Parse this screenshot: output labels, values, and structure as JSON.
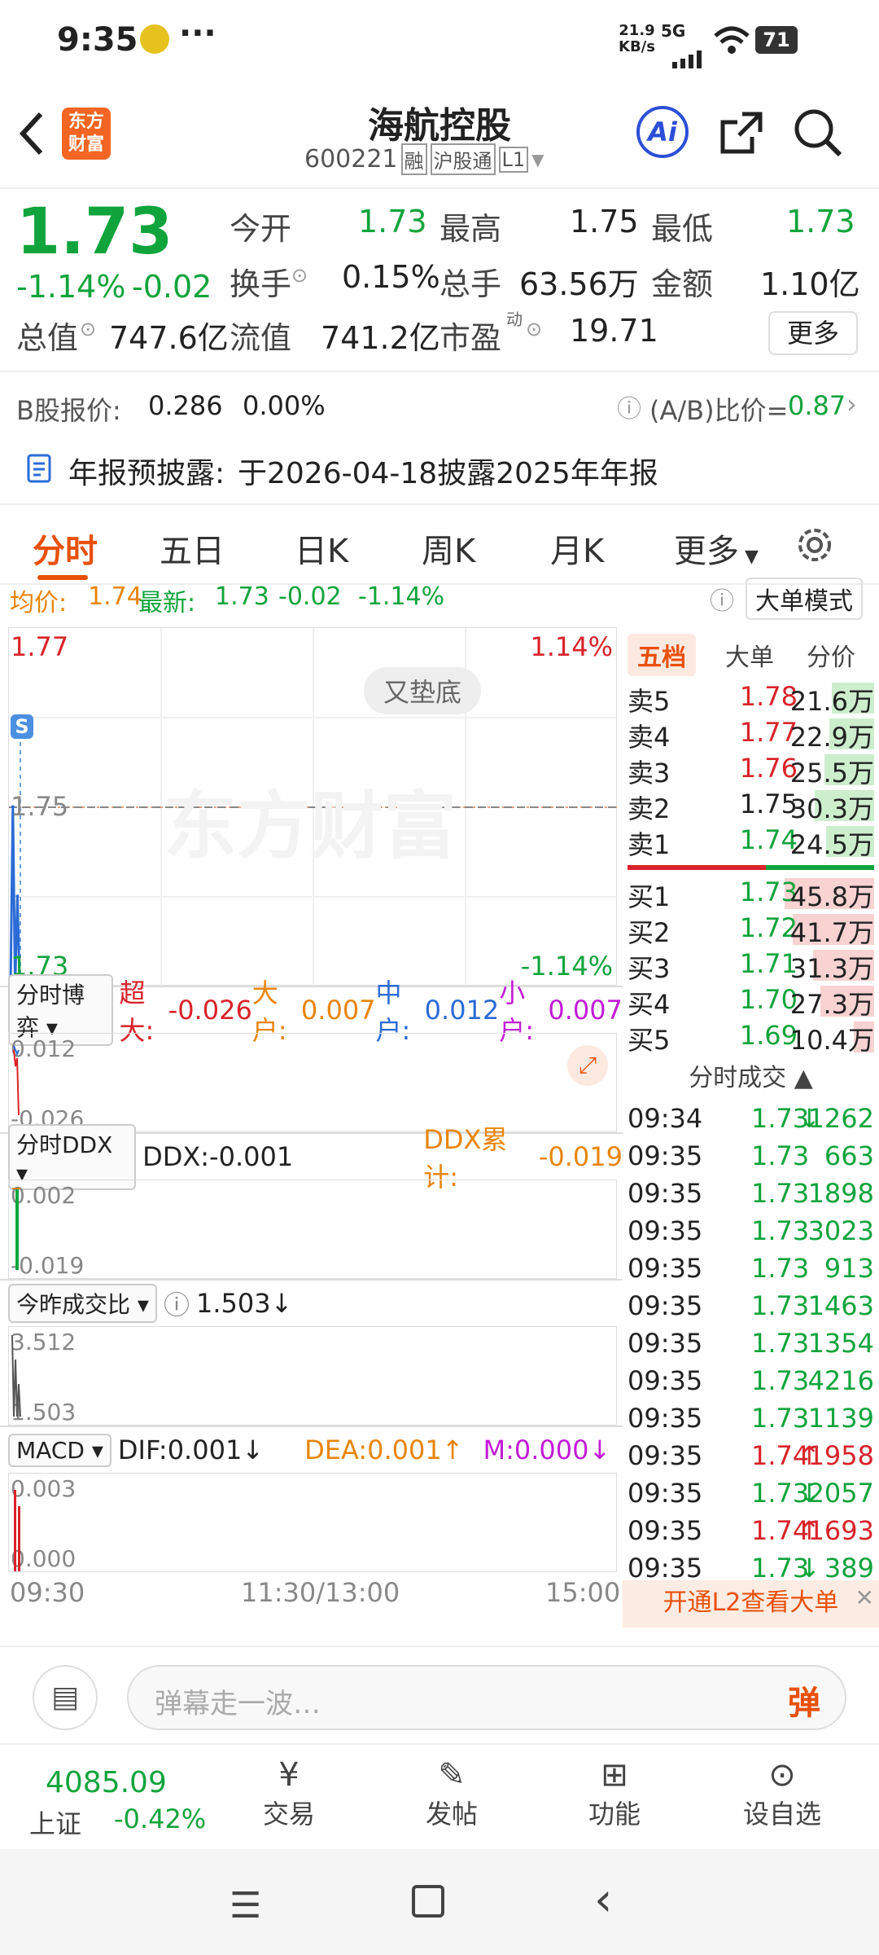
{
  "status": {
    "time": "9:35",
    "net_speed": "21.9",
    "net_unit": "KB/s",
    "net_type": "5G",
    "battery": "71"
  },
  "header": {
    "title": "海航控股",
    "code": "600221",
    "tag_rong": "融",
    "tag_hgt": "沪股通",
    "tag_level": "L1",
    "logo_line1": "东方",
    "logo_line2": "财富",
    "ai": "Ai"
  },
  "quote": {
    "price": "1.73",
    "change_pct": "-1.14%",
    "change": "-0.02",
    "open_label": "今开",
    "open": "1.73",
    "high_label": "最高",
    "high": "1.75",
    "low_label": "最低",
    "low": "1.73",
    "turnover_label": "换手",
    "turnover": "0.15%",
    "volume_label": "总手",
    "volume": "63.56万",
    "amount_label": "金额",
    "amount": "1.10亿",
    "mktcap_label": "总值",
    "mktcap": "747.6亿",
    "float_label": "流值",
    "float": "741.2亿",
    "pe_label": "市盈",
    "pe_sup": "动",
    "pe": "19.71",
    "more": "更多"
  },
  "bshare": {
    "label": "B股报价:",
    "price": "0.286",
    "pct": "0.00%",
    "ratio_label": "(A/B)比价=",
    "ratio": "0.87"
  },
  "notice": {
    "label": "年报预披露:",
    "text": "于2026-04-18披露2025年年报"
  },
  "tabs": [
    "分时",
    "五日",
    "日K",
    "周K",
    "月K",
    "更多"
  ],
  "chart": {
    "avg_label": "均价:",
    "avg": "1.74",
    "last_label": "最新:",
    "last": "1.73",
    "chg": "-0.02",
    "pct": "-1.14%",
    "big_mode": "大单模式",
    "top_price": "1.77",
    "top_pct": "1.14%",
    "mid_price": "1.75",
    "bot_price": "1.73",
    "bot_pct": "-1.14%",
    "watermark": "东方财富",
    "pattern_badge": "又垫底",
    "s_marker": "S",
    "time_start": "09:30",
    "time_mid": "11:30/13:00",
    "time_end": "15:00"
  },
  "chart_data": {
    "type": "line",
    "x": [
      "09:30",
      "09:31",
      "09:32",
      "09:33",
      "09:34",
      "09:35"
    ],
    "series": [
      {
        "name": "最新",
        "values": [
          1.73,
          1.75,
          1.73,
          1.74,
          1.73,
          1.73
        ]
      }
    ],
    "ylim": [
      1.73,
      1.77
    ]
  },
  "sub1": {
    "name": "分时博弈",
    "big_label": "超大:",
    "big": "-0.026",
    "large_label": "大户:",
    "large": "0.007",
    "mid_label": "中户:",
    "mid": "0.012",
    "small_label": "小户:",
    "small": "0.007",
    "ytop": "0.012",
    "ybot": "-0.026"
  },
  "sub2": {
    "name": "分时DDX",
    "ddx_label": "DDX:",
    "ddx": "-0.001",
    "cum_label": "DDX累计:",
    "cum": "-0.019",
    "ytop": "0.002",
    "ybot": "-0.019"
  },
  "sub3": {
    "name": "今昨成交比",
    "value": "1.503",
    "ytop": "3.512",
    "ybot": "1.503"
  },
  "sub4": {
    "name": "MACD",
    "dif_label": "DIF:",
    "dif": "0.001",
    "dea_label": "DEA:",
    "dea": "0.001",
    "m_label": "M:",
    "m": "0.000",
    "ytop": "0.003",
    "ybot": "0.000"
  },
  "side_tabs": [
    "五档",
    "大单",
    "分价"
  ],
  "asks": [
    {
      "label": "卖5",
      "price": "1.78",
      "vol": "21.6万"
    },
    {
      "label": "卖4",
      "price": "1.77",
      "vol": "22.9万"
    },
    {
      "label": "卖3",
      "price": "1.76",
      "vol": "25.5万"
    },
    {
      "label": "卖2",
      "price": "1.75",
      "vol": "30.3万"
    },
    {
      "label": "卖1",
      "price": "1.74",
      "vol": "24.5万"
    }
  ],
  "bids": [
    {
      "label": "买1",
      "price": "1.73",
      "vol": "45.8万"
    },
    {
      "label": "买2",
      "price": "1.72",
      "vol": "41.7万"
    },
    {
      "label": "买3",
      "price": "1.71",
      "vol": "31.3万"
    },
    {
      "label": "买4",
      "price": "1.70",
      "vol": "27.3万"
    },
    {
      "label": "买5",
      "price": "1.69",
      "vol": "10.4万"
    }
  ],
  "trades_title": "分时成交",
  "trades": [
    {
      "t": "09:34",
      "p": "1.73",
      "d": "↓",
      "v": "1262"
    },
    {
      "t": "09:35",
      "p": "1.73",
      "d": "",
      "v": "663"
    },
    {
      "t": "09:35",
      "p": "1.73",
      "d": "",
      "v": "1898"
    },
    {
      "t": "09:35",
      "p": "1.73",
      "d": "",
      "v": "3023"
    },
    {
      "t": "09:35",
      "p": "1.73",
      "d": "",
      "v": "913"
    },
    {
      "t": "09:35",
      "p": "1.73",
      "d": "",
      "v": "1463"
    },
    {
      "t": "09:35",
      "p": "1.73",
      "d": "",
      "v": "1354"
    },
    {
      "t": "09:35",
      "p": "1.73",
      "d": "",
      "v": "4216"
    },
    {
      "t": "09:35",
      "p": "1.73",
      "d": "",
      "v": "1139"
    },
    {
      "t": "09:35",
      "p": "1.74",
      "d": "↑",
      "v": "1958"
    },
    {
      "t": "09:35",
      "p": "1.73",
      "d": "↓",
      "v": "2057"
    },
    {
      "t": "09:35",
      "p": "1.74",
      "d": "↑",
      "v": "1693"
    },
    {
      "t": "09:35",
      "p": "1.73",
      "d": "↓",
      "v": "389"
    }
  ],
  "l2_banner": "开通L2查看大单",
  "danmu": {
    "placeholder": "弹幕走一波…",
    "btn": "弹"
  },
  "bottom": {
    "index_value": "4085.09",
    "index_name": "上证",
    "index_pct": "-0.42%",
    "trade": "交易",
    "post": "发帖",
    "func": "功能",
    "watch": "设自选"
  },
  "colors": {
    "up": "#d9232a",
    "down": "#11a43c",
    "accent": "#e8500a",
    "brand": "#f26522"
  }
}
